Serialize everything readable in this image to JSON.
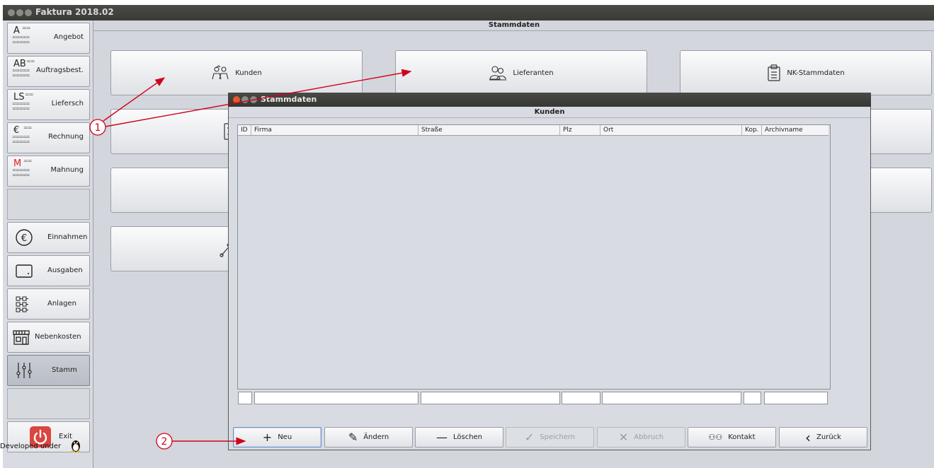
{
  "app": {
    "title": "Faktura 2018.02"
  },
  "sidebar": {
    "documents": [
      {
        "abbr": "A",
        "label": "Angebot",
        "color": "#222222"
      },
      {
        "abbr": "AB",
        "label": "Auftragsbest.",
        "color": "#222222"
      },
      {
        "abbr": "LS",
        "label": "Liefersch",
        "color": "#222222"
      },
      {
        "abbr": "€",
        "label": "Rechnung",
        "color": "#222222"
      },
      {
        "abbr": "M",
        "label": "Mahnung",
        "color": "#e02020"
      }
    ],
    "doc_eq": "==",
    "doc_lines": "=====\n=====",
    "items": [
      {
        "label": "Einnahmen",
        "icon": "euro-icon"
      },
      {
        "label": "Ausgaben",
        "icon": "wallet-icon"
      },
      {
        "label": "Anlagen",
        "icon": "asset-grid-icon"
      },
      {
        "label": "Nebenkosten",
        "icon": "storefront-icon"
      },
      {
        "label": "Stamm",
        "icon": "sliders-icon"
      }
    ],
    "exit_label": "Exit",
    "footer": "Developed under"
  },
  "stammdaten": {
    "header": "Stammdaten",
    "buttons": [
      {
        "label": "Kunden",
        "icon": "customers-icon"
      },
      {
        "label": "Lieferanten",
        "icon": "suppliers-icon"
      },
      {
        "label": "NK-Stammdaten",
        "icon": "clipboard-icon"
      }
    ]
  },
  "dialog": {
    "title": "Stammdaten",
    "header": "Kunden",
    "columns": [
      "ID",
      "Firma",
      "Straße",
      "Plz",
      "Ort",
      "Kop.",
      "Archivname"
    ],
    "buttons": [
      {
        "label": "Neu",
        "glyph": "+",
        "icon": "plus-icon",
        "enabled": true,
        "focused": true
      },
      {
        "label": "Ändern",
        "glyph": "✎",
        "icon": "pencil-icon",
        "enabled": true
      },
      {
        "label": "Löschen",
        "glyph": "—",
        "icon": "minus-icon",
        "enabled": true
      },
      {
        "label": "Speichern",
        "glyph": "✓",
        "icon": "check-icon",
        "enabled": false
      },
      {
        "label": "Abbruch",
        "glyph": "✕",
        "icon": "x-icon",
        "enabled": false
      },
      {
        "label": "Kontakt",
        "glyph": "⚇⚇",
        "icon": "contacts-icon",
        "enabled": true
      },
      {
        "label": "Zurück",
        "glyph": "‹",
        "icon": "chevron-left-icon",
        "enabled": true
      }
    ]
  },
  "annotations": {
    "marker1": "1",
    "marker2": "2",
    "color": "#d0021b"
  }
}
